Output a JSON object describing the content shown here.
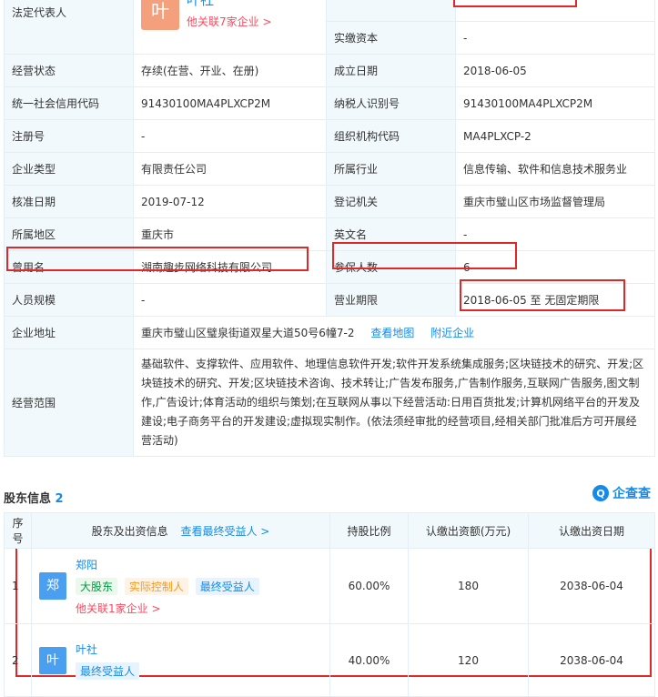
{
  "info": {
    "legal_rep": {
      "label": "法定代表人",
      "avatar_char": "叶",
      "name": "叶社",
      "related": "他关联7家企业 >"
    },
    "paid_capital": {
      "label": "实缴资本",
      "value": "-"
    },
    "rows": [
      {
        "l1": "经营状态",
        "v1": "存续(在营、开业、在册)",
        "l2": "成立日期",
        "v2": "2018-06-05"
      },
      {
        "l1": "统一社会信用代码",
        "v1": "91430100MA4PLXCP2M",
        "l2": "纳税人识别号",
        "v2": "91430100MA4PLXCP2M"
      },
      {
        "l1": "注册号",
        "v1": "-",
        "l2": "组织机构代码",
        "v2": "MA4PLXCP-2"
      },
      {
        "l1": "企业类型",
        "v1": "有限责任公司",
        "l2": "所属行业",
        "v2": "信息传输、软件和信息技术服务业"
      },
      {
        "l1": "核准日期",
        "v1": "2019-07-12",
        "l2": "登记机关",
        "v2": "重庆市璧山区市场监督管理局"
      },
      {
        "l1": "所属地区",
        "v1": "重庆市",
        "l2": "英文名",
        "v2": "-"
      },
      {
        "l1": "曾用名",
        "v1": "湖南趣步网络科技有限公司",
        "l2": "参保人数",
        "v2": "6"
      },
      {
        "l1": "人员规模",
        "v1": "-",
        "l2": "营业期限",
        "v2": "2018-06-05 至 无固定期限"
      }
    ],
    "address": {
      "label": "企业地址",
      "value": "重庆市璧山区璧泉街道双星大道50号6幢7-2",
      "map_link": "查看地图",
      "nearby_link": "附近企业"
    },
    "scope": {
      "label": "经营范围",
      "value": "基础软件、支撑软件、应用软件、地理信息软件开发;软件开发系统集成服务;区块链技术的研究、开发;区块链技术的研究、开发;区块链技术咨询、技术转让;广告发布服务,广告制作服务,互联网广告服务,图文制作,广告设计;体育活动的组织与策划;在互联网从事以下经营活动:日用百货批发;计算机网络平台的开发及建设;电子商务平台的开发建设;虚拟现实制作。(依法须经审批的经营项目,经相关部门批准后方可开展经营活动)"
    }
  },
  "shareholders": {
    "title": "股东信息",
    "count": "2",
    "brand": "企查查",
    "brand_icon": "Q",
    "headers": {
      "no": "序号",
      "name": "股东及出资信息",
      "beneficiary_link": "查看最终受益人 >",
      "ratio": "持股比例",
      "amount": "认缴出资额(万元)",
      "date": "认缴出资日期"
    },
    "rows": [
      {
        "no": "1",
        "avatar": "郑",
        "name": "郑阳",
        "tags": [
          "大股东",
          "实际控制人",
          "最终受益人"
        ],
        "related": "他关联1家企业 >",
        "ratio": "60.00%",
        "amount": "180",
        "date": "2038-06-04"
      },
      {
        "no": "2",
        "avatar": "叶",
        "name": "叶社",
        "tags": [
          "最终受益人"
        ],
        "ratio": "40.00%",
        "amount": "120",
        "date": "2038-06-04"
      }
    ]
  }
}
